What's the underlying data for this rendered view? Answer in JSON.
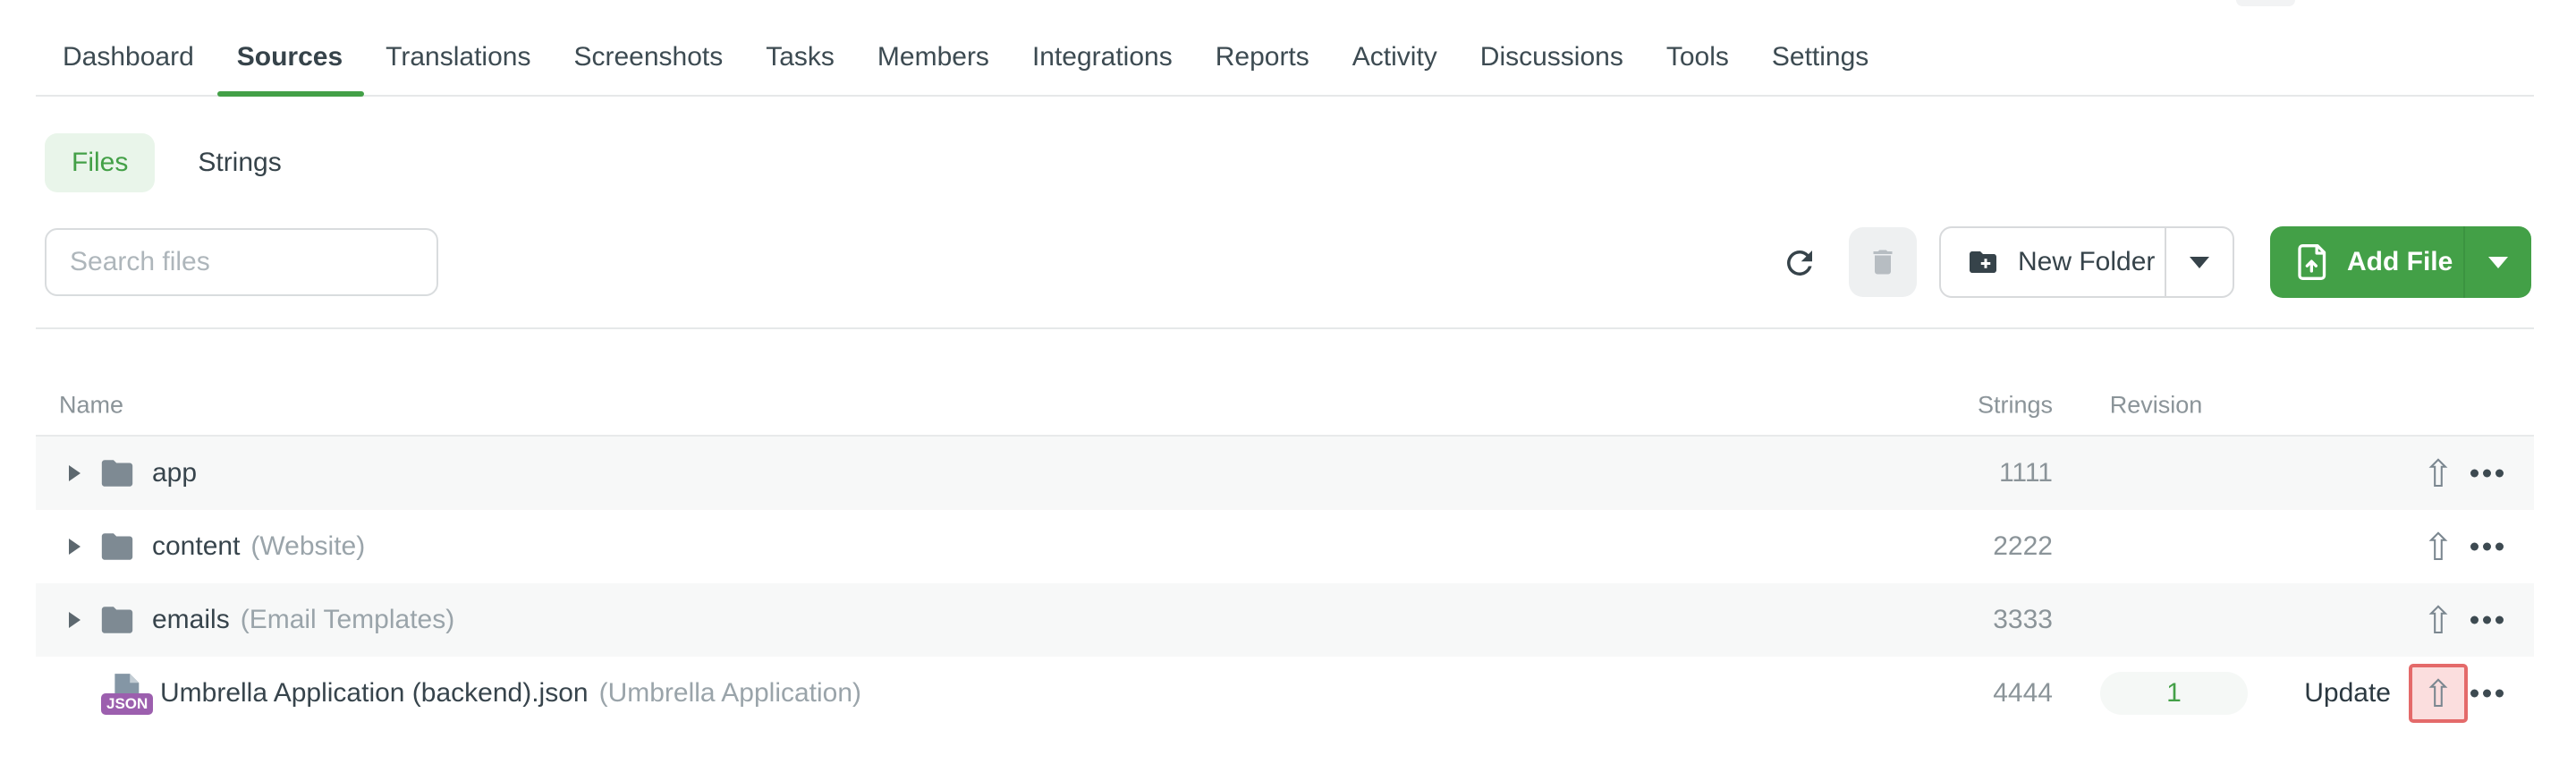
{
  "nav": {
    "items": [
      {
        "label": "Dashboard",
        "active": false
      },
      {
        "label": "Sources",
        "active": true
      },
      {
        "label": "Translations",
        "active": false
      },
      {
        "label": "Screenshots",
        "active": false
      },
      {
        "label": "Tasks",
        "active": false
      },
      {
        "label": "Members",
        "active": false
      },
      {
        "label": "Integrations",
        "active": false
      },
      {
        "label": "Reports",
        "active": false
      },
      {
        "label": "Activity",
        "active": false
      },
      {
        "label": "Discussions",
        "active": false
      },
      {
        "label": "Tools",
        "active": false
      },
      {
        "label": "Settings",
        "active": false
      }
    ]
  },
  "tabs": [
    {
      "label": "Files",
      "active": true
    },
    {
      "label": "Strings",
      "active": false
    }
  ],
  "toolbar": {
    "search_placeholder": "Search files",
    "refresh_icon": "refresh-icon",
    "delete_icon": "trash-icon",
    "new_folder_label": "New Folder",
    "new_folder_icon": "folder-plus-icon",
    "add_file_label": "Add File",
    "add_file_icon": "file-upload-icon"
  },
  "table": {
    "headers": {
      "name": "Name",
      "strings": "Strings",
      "revision": "Revision"
    },
    "rows": [
      {
        "type": "folder",
        "name": "app",
        "annotation": "",
        "strings": "1111"
      },
      {
        "type": "folder",
        "name": "content",
        "annotation": "(Website)",
        "strings": "2222"
      },
      {
        "type": "folder",
        "name": "emails",
        "annotation": "(Email Templates)",
        "strings": "3333"
      },
      {
        "type": "file",
        "name": "Umbrella Application (backend).json",
        "annotation": "(Umbrella Application)",
        "strings": "4444",
        "revision": "1",
        "update_label": "Update",
        "badge": "JSON",
        "upload_highlighted": true
      }
    ]
  },
  "colors": {
    "accent_green": "#43a047",
    "files_tab_bg": "#e9f5ea",
    "row_stripe": "#f7f8f8",
    "divider": "#e6e8e9",
    "muted_text": "#8b9499",
    "dark_text": "#36434a",
    "folder_icon": "#7e8a93",
    "json_badge": "#9c5fae",
    "highlight_border": "#e46a6a",
    "highlight_bg": "#fbdede",
    "trash_button_bg": "#eef0f1"
  }
}
